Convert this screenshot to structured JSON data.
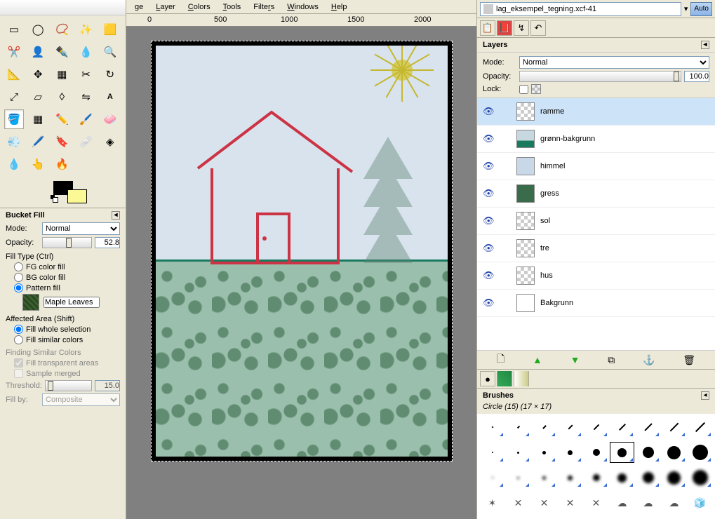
{
  "menus": {
    "image": "ge",
    "layer": "Layer",
    "colors": "Colors",
    "tools": "Tools",
    "filters": "Filters",
    "windows": "Windows",
    "help": "Help"
  },
  "ruler": {
    "m0": "0",
    "m500": "500",
    "m1000": "1000",
    "m1500": "1500",
    "m2000": "2000"
  },
  "toolopts": {
    "title": "Bucket Fill",
    "mode_label": "Mode:",
    "mode_value": "Normal",
    "opacity_label": "Opacity:",
    "opacity_value": "52.8",
    "filltype_label": "Fill Type  (Ctrl)",
    "fg_fill": "FG color fill",
    "bg_fill": "BG color fill",
    "pattern_fill": "Pattern fill",
    "pattern_name": "Maple Leaves",
    "affected_label": "Affected Area  (Shift)",
    "fill_whole": "Fill whole selection",
    "fill_similar": "Fill similar colors",
    "finding_label": "Finding Similar Colors",
    "fill_transparent": "Fill transparent areas",
    "sample_merged": "Sample merged",
    "threshold_label": "Threshold:",
    "threshold_value": "15.0",
    "fillby_label": "Fill by:",
    "fillby_value": "Composite"
  },
  "dock": {
    "image_name": "lag_eksempel_tegning.xcf-41",
    "auto": "Auto",
    "layers_title": "Layers",
    "mode_label": "Mode:",
    "mode_value": "Normal",
    "opacity_label": "Opacity:",
    "opacity_value": "100.0",
    "lock_label": "Lock:",
    "layers": [
      {
        "name": "ramme",
        "thumb": "checker"
      },
      {
        "name": "grønn-bakgrunn",
        "thumb": "green"
      },
      {
        "name": "himmel",
        "thumb": "sky"
      },
      {
        "name": "gress",
        "thumb": "grass"
      },
      {
        "name": "sol",
        "thumb": "checker"
      },
      {
        "name": "tre",
        "thumb": "checker"
      },
      {
        "name": "hus",
        "thumb": "checker"
      },
      {
        "name": "Bakgrunn",
        "thumb": "white"
      }
    ],
    "brushes_title": "Brushes",
    "brush_sub": "Circle (15) (17 × 17)"
  }
}
